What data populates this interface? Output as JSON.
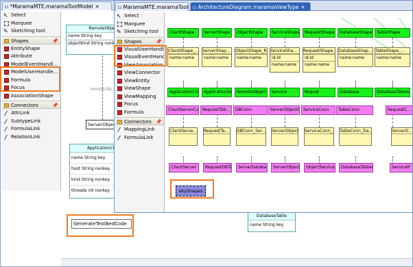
{
  "tabs": {
    "back": "*MaramaMTE.maramaToolModel",
    "middle": "MaramaMTE.maramaToolModel",
    "active": "ArchitectureDiagram.maramaViewType",
    "close": "✕"
  },
  "back_palette": {
    "tools": [
      "Select",
      "Marquee",
      "Sketching tool"
    ],
    "shapes_header": "Shapes",
    "shapes": [
      "EntityShape",
      "Attribute",
      "ModelEventHandl...",
      "ModelUserHandle...",
      "Formula",
      "Focus",
      "AssociationShape"
    ],
    "connectors_header": "Connectors",
    "connectors": [
      "AttrLink",
      "SubtypeLink",
      "FormulaLink",
      "RelationLink"
    ]
  },
  "front_palette": {
    "tools": [
      "Select",
      "Marquee",
      "Sketching tool"
    ],
    "shapes_header": "Shapes",
    "shapes": [
      "VisualUserHandler...",
      "VisualEventHand...",
      "ViewAssociation",
      "ViewConnector",
      "ViewEntity",
      "ViewShape",
      "ViewMapping",
      "Focus",
      "Formula"
    ],
    "connectors_header": "Connectors",
    "connectors": [
      "MappingLink",
      "FormulaLink"
    ]
  },
  "back_canvas": {
    "remote_title": "RemoteObject",
    "remote_attrs": [
      "name String key",
      "objectKind String nonk"
    ],
    "remote_link": "remoteObj...",
    "server_obj": "ServerObject",
    "appclient_title": "ApplicationCli",
    "appclient_attrs": [
      "name String key",
      "host String nonkey",
      "kind String nonkey",
      "threads int nonkey"
    ],
    "gen_button": "GenerateTestBedCode",
    "dbtable_title": "DatabaseTable",
    "dbtable_attr": "name String key"
  },
  "diagram": {
    "row1_shapes": [
      "ClientShape",
      "ServerShape",
      "ObjectShape",
      "ServiceShape",
      "RequestShape",
      "DatabaseShape",
      "TableShape"
    ],
    "row2_views": [
      {
        "title": "ClientShape_...",
        "lines": [
          "name:name"
        ]
      },
      {
        "title": "ServerShap...",
        "lines": [
          "name:name"
        ]
      },
      {
        "title": "ObjectShape_R...",
        "lines": [
          "name:name"
        ]
      },
      {
        "title": "ServiceSha...",
        "lines": [
          "id:id",
          "name:name"
        ]
      },
      {
        "title": "RequestShape...",
        "lines": [
          "id:id",
          "name:name"
        ]
      },
      {
        "title": "DatabaseShap...",
        "lines": [
          "name:name"
        ]
      },
      {
        "title": "TableShape_...",
        "lines": [
          "name:name"
        ]
      }
    ],
    "row3_entities": [
      "ApplicationClient",
      "ApplicationSer...",
      "RemoteObject",
      "Service",
      "Requst",
      "Database",
      "DatabaseTables"
    ],
    "row4_conns": [
      "ClientServerConn",
      "RequestTab...",
      "DBConn",
      "ServerObjectConn",
      "ServiceConn",
      "TableConn",
      "RequestC..."
    ],
    "row5_views": [
      "ClientServe...",
      "RequestTa...",
      "DBConn_Ser...",
      "ServerObjectC...",
      "ServiceConn_...",
      "TableConn_Da...",
      "ServerO..."
    ],
    "row6_entities": [
      "ClientServer",
      "RequestDBTable",
      "ServerDatabase",
      "ServerObject",
      "ObjectService",
      "DatabaseTables",
      "ServiceR"
    ],
    "selected": "akyShapes"
  }
}
